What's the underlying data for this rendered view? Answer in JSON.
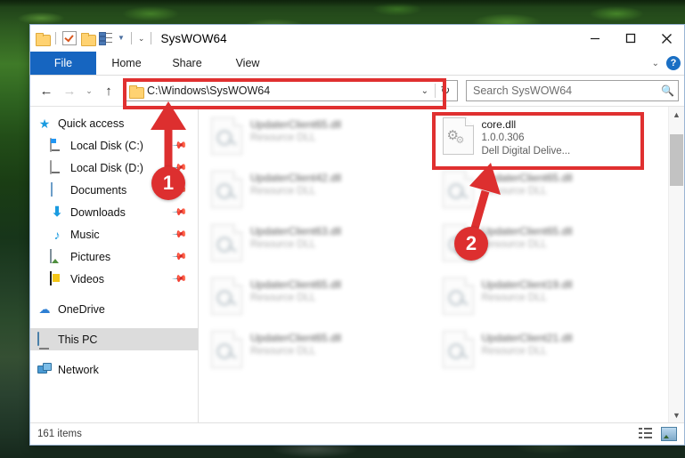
{
  "window": {
    "title": "SysWOW64",
    "quick_access": {
      "folder_icon": "folder-icon",
      "properties_icon": "properties-icon",
      "new_folder_icon": "new-folder-icon",
      "customize_icon": "customize-toolbar-icon",
      "dropdown_icon": "chevron-down-icon"
    },
    "controls": {
      "minimize": "minimize-icon",
      "maximize": "maximize-icon",
      "close": "close-icon"
    }
  },
  "ribbon": {
    "tabs": [
      {
        "label": "File"
      },
      {
        "label": "Home"
      },
      {
        "label": "Share"
      },
      {
        "label": "View"
      }
    ],
    "expand_icon": "chevron-down-icon",
    "help_label": "?"
  },
  "navigation": {
    "back_icon": "arrow-left-icon",
    "forward_icon": "arrow-right-icon",
    "recent_icon": "chevron-down-icon",
    "up_icon": "arrow-up-icon",
    "address": {
      "value": "C:\\Windows\\SysWOW64",
      "folder_icon": "folder-icon",
      "dropdown_icon": "chevron-down-icon",
      "refresh_icon": "refresh-icon"
    },
    "search": {
      "placeholder": "Search SysWOW64",
      "icon": "search-icon"
    }
  },
  "sidebar": {
    "items": [
      {
        "label": "Quick access",
        "icon": "star-icon",
        "pinned": false,
        "child": false,
        "selected": false
      },
      {
        "label": "Local Disk (C:)",
        "icon": "drive-icon",
        "pinned": true,
        "child": true,
        "selected": false
      },
      {
        "label": "Local Disk (D:)",
        "icon": "drive-icon",
        "pinned": true,
        "child": true,
        "selected": false
      },
      {
        "label": "Documents",
        "icon": "documents-icon",
        "pinned": true,
        "child": true,
        "selected": false
      },
      {
        "label": "Downloads",
        "icon": "downloads-icon",
        "pinned": true,
        "child": true,
        "selected": false
      },
      {
        "label": "Music",
        "icon": "music-icon",
        "pinned": true,
        "child": true,
        "selected": false
      },
      {
        "label": "Pictures",
        "icon": "pictures-icon",
        "pinned": true,
        "child": true,
        "selected": false
      },
      {
        "label": "Videos",
        "icon": "videos-icon",
        "pinned": true,
        "child": true,
        "selected": false
      },
      {
        "label": "OneDrive",
        "icon": "cloud-icon",
        "pinned": false,
        "child": false,
        "selected": false
      },
      {
        "label": "This PC",
        "icon": "computer-icon",
        "pinned": false,
        "child": false,
        "selected": true
      },
      {
        "label": "Network",
        "icon": "network-icon",
        "pinned": false,
        "child": false,
        "selected": false
      }
    ],
    "pin_glyph": "pin-icon"
  },
  "files": [
    {
      "name": "UpdaterClient65.dll",
      "line2": "Resource DLL",
      "line3": "",
      "blurred": true,
      "highlighted": false
    },
    {
      "name": "core.dll",
      "line2": "1.0.0.306",
      "line3": "Dell Digital Delive...",
      "blurred": false,
      "highlighted": true
    },
    {
      "name": "UpdaterClient42.dll",
      "line2": "Resource DLL",
      "line3": "",
      "blurred": true,
      "highlighted": false
    },
    {
      "name": "UpdaterClient65.dll",
      "line2": "Resource DLL",
      "line3": "",
      "blurred": true,
      "highlighted": false
    },
    {
      "name": "UpdaterClient63.dll",
      "line2": "Resource DLL",
      "line3": "",
      "blurred": true,
      "highlighted": false
    },
    {
      "name": "UpdaterClient65.dll",
      "line2": "Resource DLL",
      "line3": "",
      "blurred": true,
      "highlighted": false
    },
    {
      "name": "UpdaterClient65.dll",
      "line2": "Resource DLL",
      "line3": "",
      "blurred": true,
      "highlighted": false
    },
    {
      "name": "UpdaterClient19.dll",
      "line2": "Resource DLL",
      "line3": "",
      "blurred": true,
      "highlighted": false
    },
    {
      "name": "UpdaterClient65.dll",
      "line2": "Resource DLL",
      "line3": "",
      "blurred": true,
      "highlighted": false
    },
    {
      "name": "UpdaterClient21.dll",
      "line2": "Resource DLL",
      "line3": "",
      "blurred": true,
      "highlighted": false
    }
  ],
  "scrollbar": {
    "up_icon": "chevron-up-icon",
    "down_icon": "chevron-down-icon"
  },
  "status": {
    "item_count": "161 items",
    "details_view_icon": "details-view-icon",
    "tiles_view_icon": "large-icons-view-icon"
  },
  "annotations": {
    "accent_color": "#e03030",
    "markers": [
      {
        "number": "1",
        "target": "address-bar"
      },
      {
        "number": "2",
        "target": "core-dll-file"
      }
    ]
  }
}
